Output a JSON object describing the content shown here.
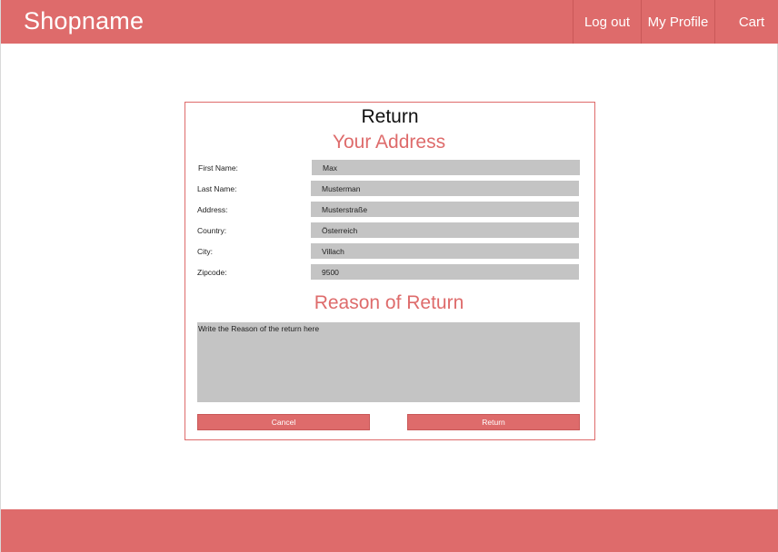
{
  "header": {
    "brand": "Shopname",
    "nav": {
      "logout": "Log out",
      "profile": "My Profile",
      "cart": "Cart"
    }
  },
  "form": {
    "title": "Return",
    "address_heading": "Your Address",
    "fields": [
      {
        "label": "First Name:",
        "value": "Max"
      },
      {
        "label": "Last Name:",
        "value": "Musterman"
      },
      {
        "label": "Address:",
        "value": "Musterstraße"
      },
      {
        "label": "Country:",
        "value": "Österreich"
      },
      {
        "label": "City:",
        "value": "Villach"
      },
      {
        "label": "Zipcode:",
        "value": "9500"
      }
    ],
    "reason_heading": "Reason of Return",
    "reason_placeholder": "Write the Reason of the return here",
    "cancel_label": "Cancel",
    "return_label": "Return"
  },
  "colors": {
    "accent": "#de6b6b",
    "input_bg": "#c4c4c4",
    "background": "#ffffff"
  }
}
